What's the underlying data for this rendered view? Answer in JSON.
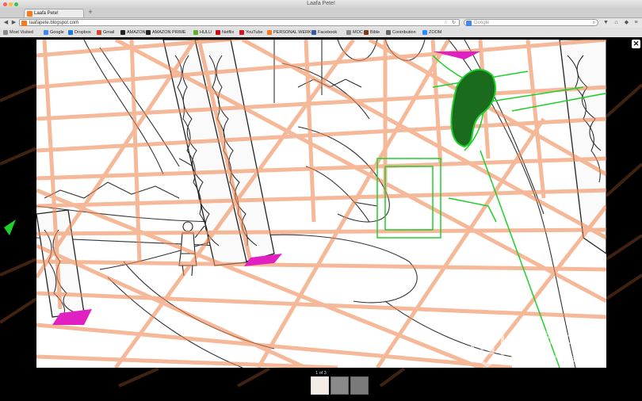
{
  "window": {
    "title": "Laafa Pete!"
  },
  "tab": {
    "title": "Laafa Pete!"
  },
  "nav": {
    "url": "laafapete.blogspot.com",
    "search_placeholder": "Google"
  },
  "bookmarks": [
    {
      "label": "Most Visited",
      "icon": "most-visited-icon",
      "color": "#8a8a8a"
    },
    {
      "label": "Google",
      "icon": "google-icon",
      "color": "#4285f4"
    },
    {
      "label": "Dropbox",
      "icon": "dropbox-icon",
      "color": "#1f7ad6"
    },
    {
      "label": "Gmail",
      "icon": "gmail-icon",
      "color": "#d44638"
    },
    {
      "label": "AMAZON",
      "icon": "amazon-icon",
      "color": "#222222"
    },
    {
      "label": "AMAZON PRIME",
      "icon": "amazon-icon",
      "color": "#222222"
    },
    {
      "label": "HULU",
      "icon": "hulu-icon",
      "color": "#66aa33"
    },
    {
      "label": "Netflix",
      "icon": "netflix-icon",
      "color": "#c11119"
    },
    {
      "label": "YouTube",
      "icon": "youtube-icon",
      "color": "#cc181e"
    },
    {
      "label": "PERSONAL WERK",
      "icon": "blogger-icon",
      "color": "#f47b20"
    },
    {
      "label": "Facebook",
      "icon": "facebook-icon",
      "color": "#3b5998"
    },
    {
      "label": "MOC",
      "icon": "moc-icon",
      "color": "#888888"
    },
    {
      "label": "Bible",
      "icon": "bible-icon",
      "color": "#7a3c1e"
    },
    {
      "label": "Contribution",
      "icon": "contribution-icon",
      "color": "#666666"
    },
    {
      "label": "ZOOM",
      "icon": "zoom-icon",
      "color": "#2d8cff"
    }
  ],
  "lightbox": {
    "counter": "1 of 3",
    "close": "✕"
  },
  "watermark": {
    "brand": "灵感中国",
    "url": "lingganchina.com"
  },
  "colors": {
    "sketch_orange": "#f08a55",
    "sketch_green": "#1fcf2a",
    "accent_magenta": "#e020c0"
  }
}
